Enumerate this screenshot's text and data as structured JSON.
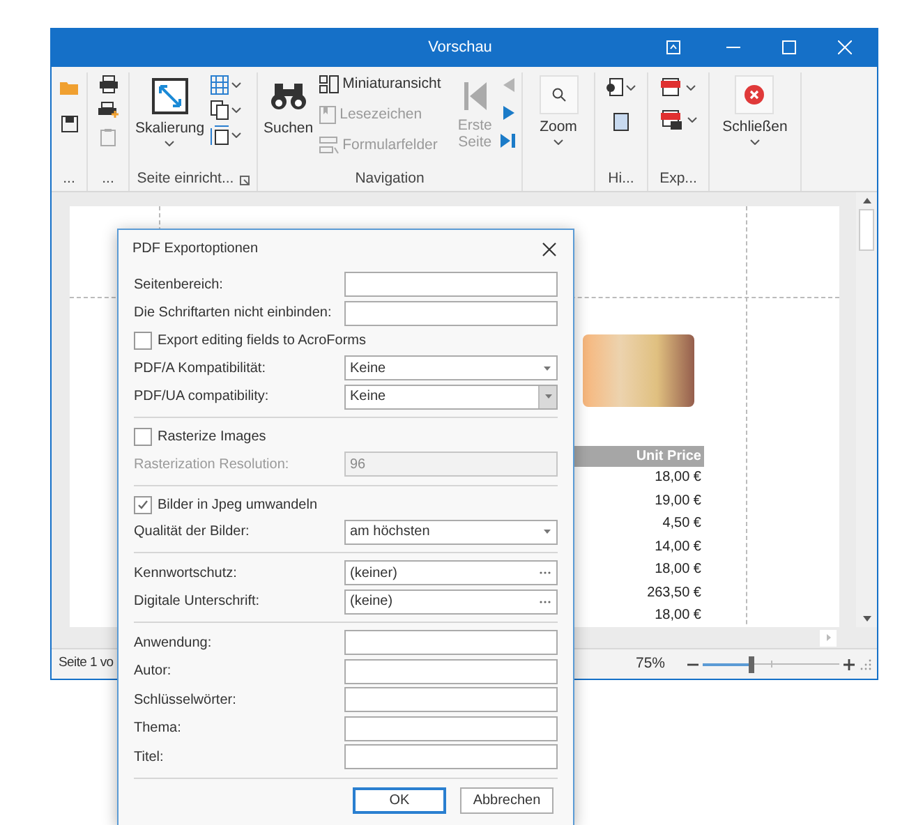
{
  "window": {
    "title": "Vorschau"
  },
  "ribbon": {
    "file_group": {
      "label": "..."
    },
    "print_group": {
      "label": "...",
      "clipboard_disabled": true
    },
    "page_setup": {
      "label": "Seite einricht...",
      "scale_button": "Skalierung"
    },
    "navigation": {
      "label": "Navigation",
      "search_button": "Suchen",
      "links": [
        {
          "kind": "thumbnails",
          "label": "Miniaturansicht",
          "disabled": false
        },
        {
          "kind": "bookmarks",
          "label": "Lesezeichen",
          "disabled": true
        },
        {
          "kind": "form_fields",
          "label": "Formularfelder",
          "disabled": true
        }
      ],
      "first_page": {
        "label": "Erste Seite",
        "disabled": true
      },
      "arrows": [
        {
          "kind": "previous",
          "disabled": true
        },
        {
          "kind": "next",
          "disabled": false
        },
        {
          "kind": "last",
          "disabled": false
        }
      ]
    },
    "zoom_group": {
      "zoom_button": "Zoom"
    },
    "background_group": {
      "label": "Hi..."
    },
    "export_group": {
      "label": "Exp..."
    },
    "close_group": {
      "close_button": "Schließen"
    }
  },
  "document": {
    "price_header": "Unit Price",
    "prices": [
      "18,00 €",
      "19,00 €",
      "4,50 €",
      "14,00 €",
      "18,00 €",
      "263,50 €",
      "18,00 €"
    ]
  },
  "status_bar": {
    "page_info": "Seite 1 vo",
    "zoom_reading": "75%",
    "zoom_slider": {
      "level": 0.36
    }
  },
  "dialog": {
    "title": "PDF Exportoptionen",
    "rows": [
      {
        "kind": "text",
        "label": "Seitenbereich:",
        "value": "",
        "disabled": false
      },
      {
        "kind": "text",
        "label": "Die Schriftarten nicht einbinden:",
        "value": "",
        "disabled": false
      },
      {
        "kind": "checkbox",
        "label": "Export editing fields to AcroForms",
        "checked": false
      },
      {
        "kind": "select",
        "label": "PDF/A Kompatibilität:",
        "value": "Keine",
        "hovered": false
      },
      {
        "kind": "select",
        "label": "PDF/UA compatibility:",
        "value": "Keine",
        "hovered": true
      },
      {
        "kind": "separator"
      },
      {
        "kind": "checkbox",
        "label": "Rasterize Images",
        "checked": false
      },
      {
        "kind": "text",
        "label": "Rasterization Resolution:",
        "value": "96",
        "disabled": true
      },
      {
        "kind": "separator"
      },
      {
        "kind": "checkbox",
        "label": "Bilder in Jpeg umwandeln",
        "checked": true
      },
      {
        "kind": "select",
        "label": "Qualität der Bilder:",
        "value": "am höchsten",
        "hovered": false
      },
      {
        "kind": "separator"
      },
      {
        "kind": "ellipsis",
        "label": "Kennwortschutz:",
        "value": "(keiner)"
      },
      {
        "kind": "ellipsis",
        "label": "Digitale Unterschrift:",
        "value": "(keine)"
      },
      {
        "kind": "separator"
      },
      {
        "kind": "text",
        "label": "Anwendung:",
        "value": "",
        "disabled": false
      },
      {
        "kind": "text",
        "label": "Autor:",
        "value": "",
        "disabled": false
      },
      {
        "kind": "text",
        "label": "Schlüsselwörter:",
        "value": "",
        "disabled": false
      },
      {
        "kind": "text",
        "label": "Thema:",
        "value": "",
        "disabled": false
      },
      {
        "kind": "text",
        "label": "Titel:",
        "value": "",
        "disabled": false
      },
      {
        "kind": "separator"
      }
    ],
    "buttons": [
      {
        "label": "OK",
        "default": true
      },
      {
        "label": "Abbrechen",
        "default": false
      }
    ]
  }
}
